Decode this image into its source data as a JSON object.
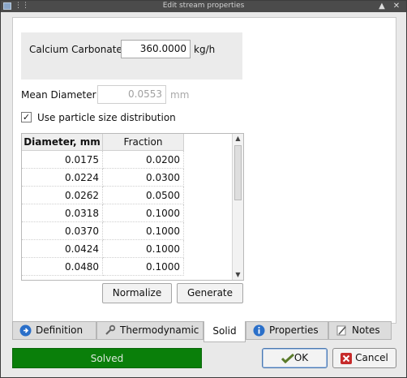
{
  "window": {
    "title": "Edit stream properties",
    "maximize_glyph": "▲",
    "close_glyph": "✕"
  },
  "component": {
    "label": "Calcium Carbonate",
    "value": "360.0000",
    "unit": "kg/h"
  },
  "mean_diameter": {
    "label": "Mean Diameter",
    "value": "0.0553",
    "unit": "mm"
  },
  "psd_checkbox": {
    "label": "Use particle size distribution",
    "checked": true,
    "mark": "✓"
  },
  "table": {
    "headers": [
      "Diameter, mm",
      "Fraction"
    ],
    "rows": [
      [
        "0.0175",
        "0.0200"
      ],
      [
        "0.0224",
        "0.0300"
      ],
      [
        "0.0262",
        "0.0500"
      ],
      [
        "0.0318",
        "0.1000"
      ],
      [
        "0.0370",
        "0.1000"
      ],
      [
        "0.0424",
        "0.1000"
      ],
      [
        "0.0480",
        "0.1000"
      ]
    ]
  },
  "actions": {
    "normalize": "Normalize",
    "generate": "Generate"
  },
  "tabs": [
    {
      "label": "Definition",
      "icon": "info-circle-icon"
    },
    {
      "label": "Thermodynamic",
      "icon": "wrench-icon"
    },
    {
      "label": "Solid",
      "icon": ""
    },
    {
      "label": "Properties",
      "icon": "info-circle-icon"
    },
    {
      "label": "Notes",
      "icon": "pencil-icon"
    }
  ],
  "active_tab": "Solid",
  "status": {
    "text": "Solved",
    "color": "#0a7f0a"
  },
  "buttons": {
    "ok": "OK",
    "cancel": "Cancel"
  }
}
